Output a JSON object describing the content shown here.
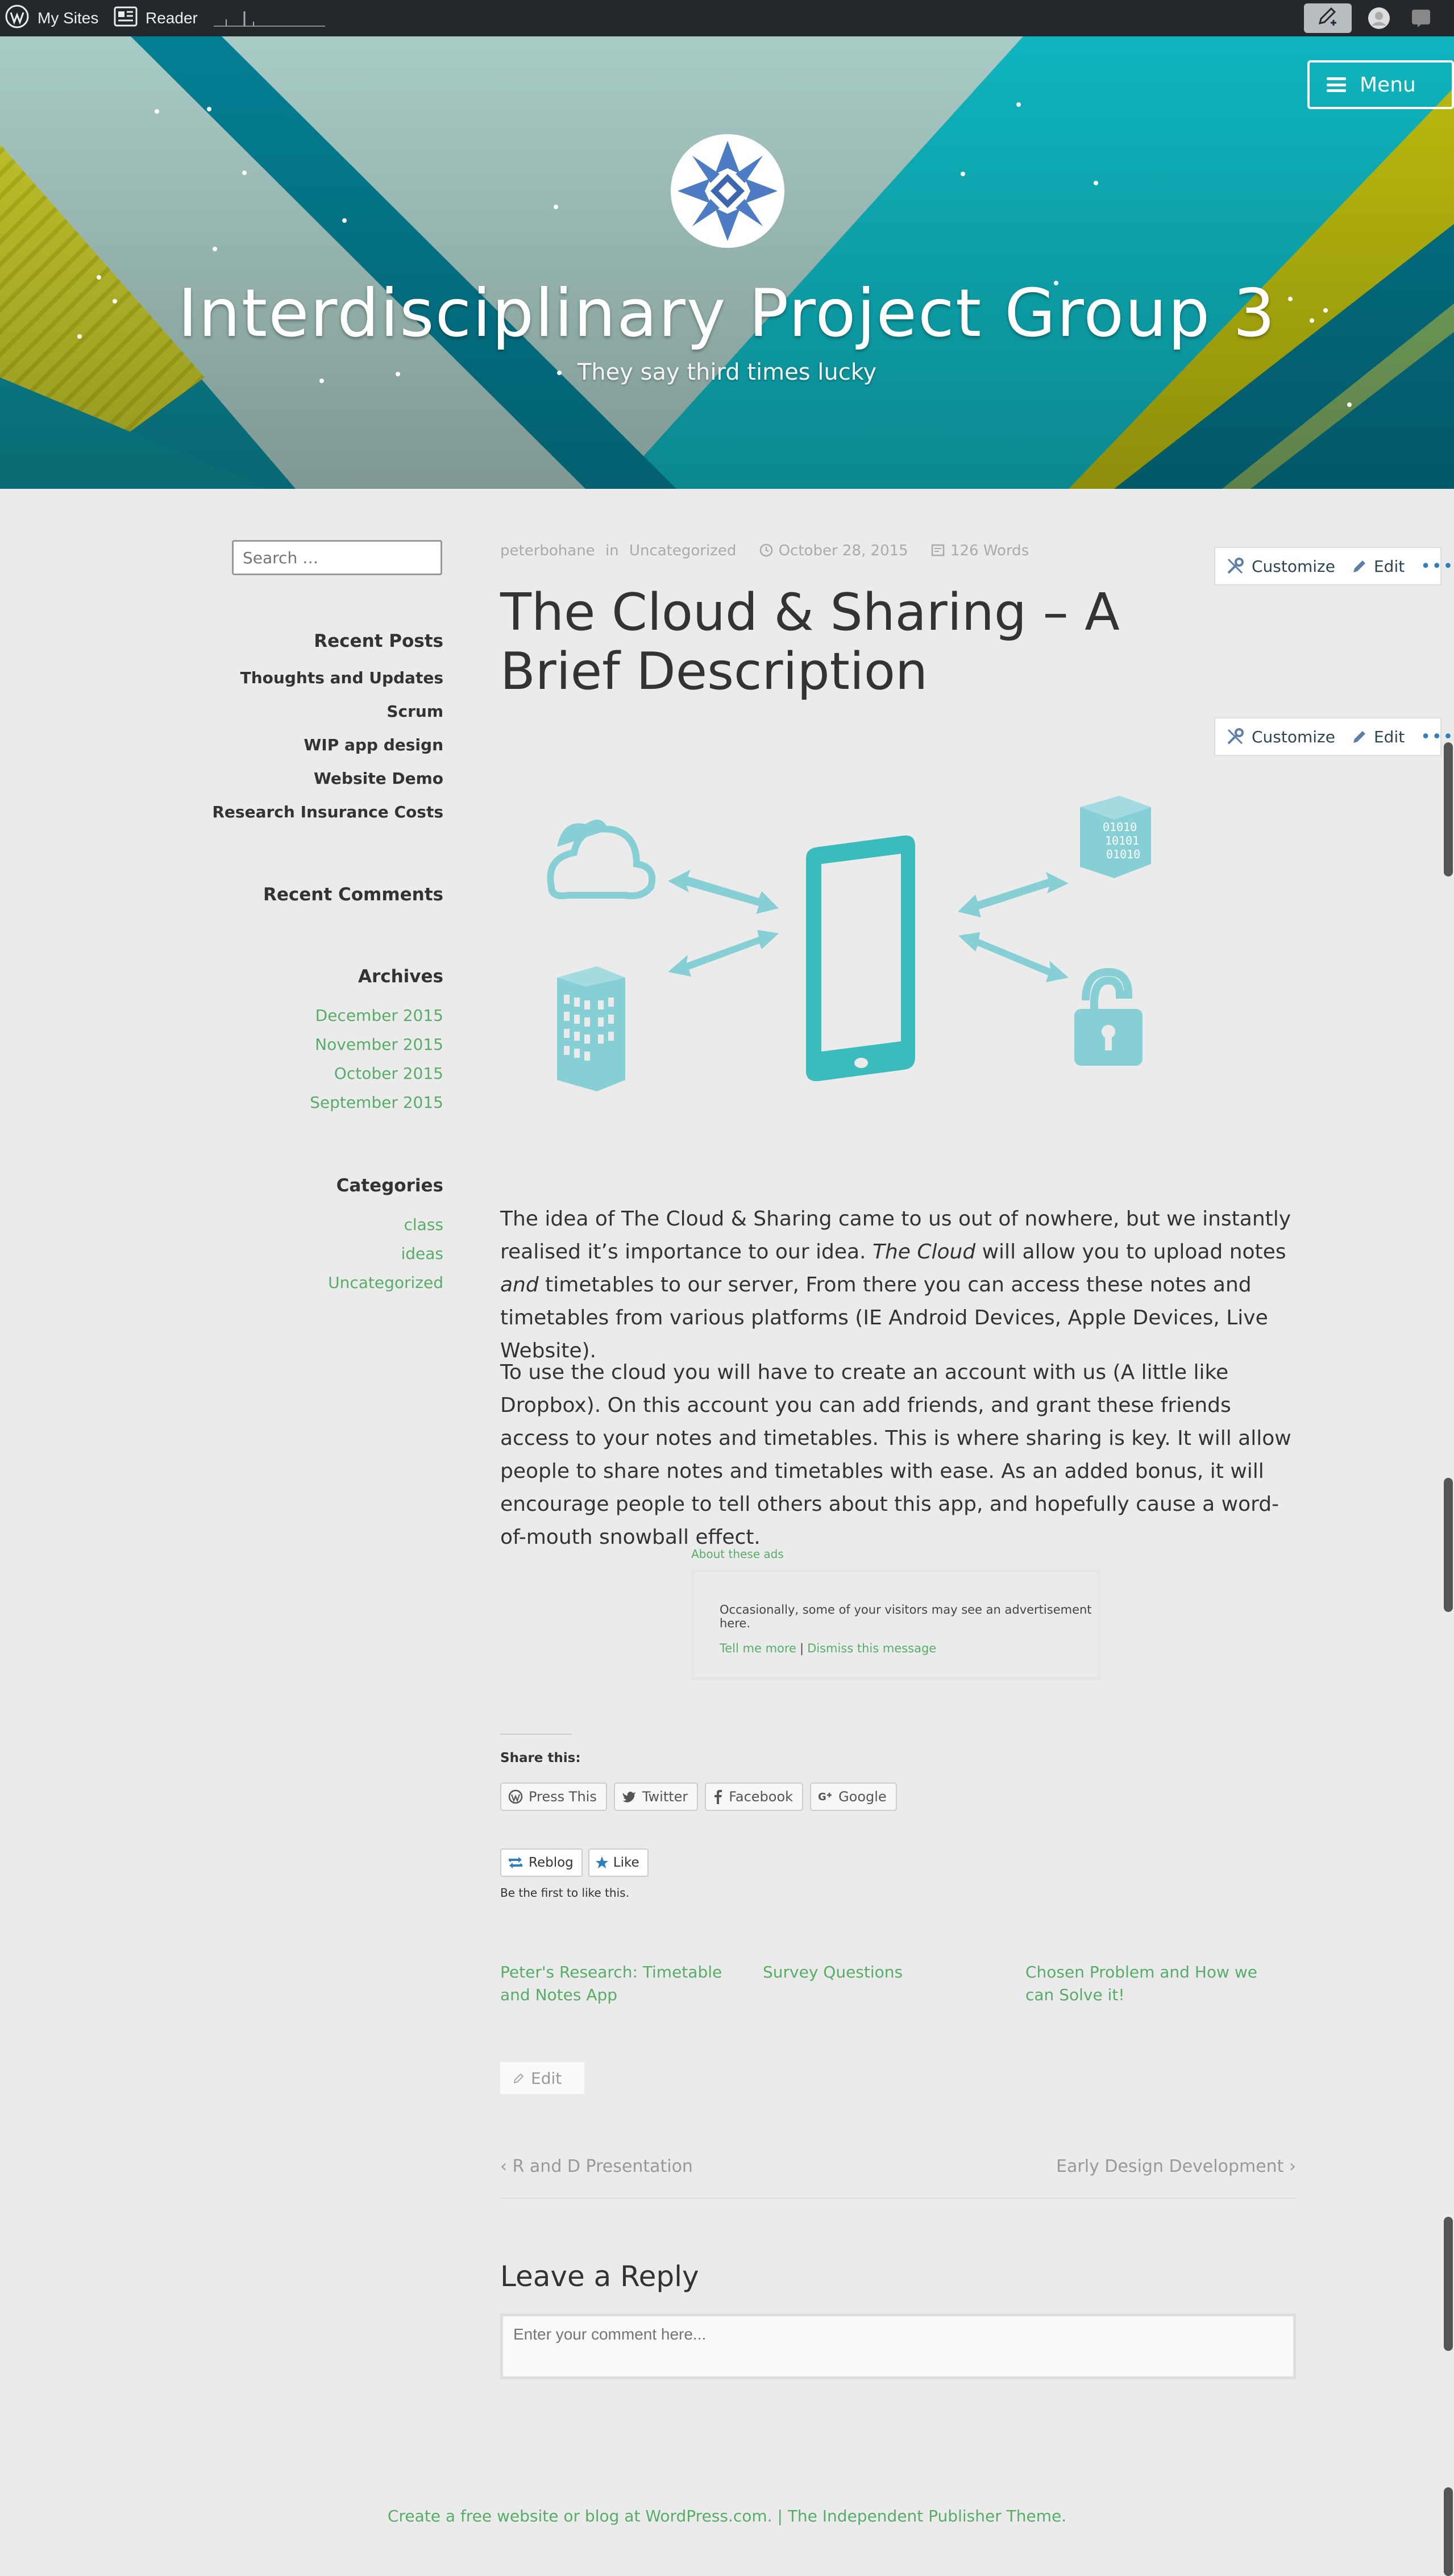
{
  "admin_bar": {
    "my_sites": "My Sites",
    "reader": "Reader"
  },
  "header": {
    "site_title": "Interdisciplinary Project Group 3",
    "tagline": "They say third times lucky",
    "menu_label": "Menu",
    "colors": {
      "teal": "#0fb5bf",
      "sage": "#a9cbc5",
      "deep_teal": "#037f94",
      "lime": "#bdbd0f"
    }
  },
  "sidebar": {
    "search_placeholder": "Search …",
    "recent_posts_title": "Recent Posts",
    "recent_posts": [
      "Thoughts and Updates",
      "Scrum",
      "WIP app design",
      "Website Demo",
      "Research Insurance Costs"
    ],
    "recent_comments_title": "Recent Comments",
    "archives_title": "Archives",
    "archives": [
      "December 2015",
      "November 2015",
      "October 2015",
      "September 2015"
    ],
    "categories_title": "Categories",
    "categories": [
      "class",
      "ideas",
      "Uncategorized"
    ]
  },
  "post": {
    "author": "peterbohane",
    "in_label": "in",
    "category": "Uncategorized",
    "date": "October 28, 2015",
    "word_count": "126 Words",
    "title": "The Cloud & Sharing – A Brief Description",
    "edit_bar": {
      "customize": "Customize",
      "edit": "Edit",
      "more": "•••"
    },
    "p1_a": "The idea of The Cloud & Sharing came to us out of nowhere, but we instantly realised it’s importance to our idea. ",
    "p1_em": "The Cloud",
    "p1_b": " will allow you to upload notes ",
    "p1_em2": "and",
    "p1_c": " timetables to our server, From there you can access these notes and timetables from various platforms (IE Android Devices, Apple Devices, Live Website).",
    "p2": "To use the cloud you will have to create an account with us (A little like Dropbox). On this account you can add friends, and grant these friends access to your notes and timetables. This is where sharing is key. It will allow people to share notes and timetables with ease. As an added bonus, it will encourage people to tell others about this app, and hopefully cause a word-of-mouth snowball effect.",
    "accent_color": "#57ad68"
  },
  "ad": {
    "label": "About these ads",
    "text": "Occasionally, some of your visitors may see an advertisement here.",
    "tell_more": "Tell me more",
    "separator": "|",
    "dismiss": "Dismiss this message"
  },
  "share": {
    "title": "Share this:",
    "buttons": [
      "Press This",
      "Twitter",
      "Facebook",
      "Google"
    ],
    "reblog": "Reblog",
    "like": "Like",
    "like_caption": "Be the first to like this."
  },
  "related": [
    "Peter's Research: Timetable and Notes App",
    "Survey Questions",
    "Chosen Problem and How we can Solve it!"
  ],
  "edit_link": "Edit",
  "post_nav": {
    "prev": "R and D Presentation",
    "next": "Early Design Development"
  },
  "reply": {
    "title": "Leave a Reply",
    "placeholder": "Enter your comment here..."
  },
  "footer": {
    "text": "Create a free website or blog at WordPress.com. | The Independent Publisher Theme."
  }
}
